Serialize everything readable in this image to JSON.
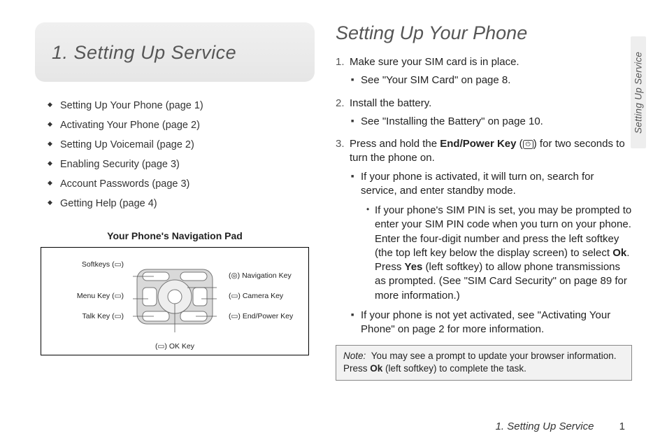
{
  "chapter_title": "1.  Setting Up Service",
  "side_tab": "Setting Up Service",
  "toc": [
    "Setting Up Your Phone (page 1)",
    "Activating Your Phone (page 2)",
    "Setting Up Voicemail (page 2)",
    "Enabling Security (page 3)",
    "Account Passwords (page 3)",
    "Getting Help (page 4)"
  ],
  "diagram": {
    "title": "Your Phone's Navigation Pad",
    "left_labels": {
      "softkeys": "Softkeys (▭)",
      "menu": "Menu Key (▭)",
      "talk": "Talk Key (▭)"
    },
    "right_labels": {
      "nav": "(◎) Navigation Key",
      "camera": "(▭) Camera Key",
      "end": "(▭) End/Power Key"
    },
    "bottom_label": "(▭) OK Key"
  },
  "section_title": "Setting Up Your Phone",
  "steps": {
    "s1": "Make sure your SIM card is in place.",
    "s1_sub": "See \"Your SIM Card\" on page 8.",
    "s2": "Install the battery.",
    "s2_sub": "See \"Installing the Battery\" on page 10.",
    "s3_a": "Press and hold the ",
    "s3_key": "End/Power Key",
    "s3_b": " (",
    "s3_c": ") for two seconds to turn the phone on.",
    "s3_sub1": "If your phone is activated, it will turn on, search for service, and enter standby mode.",
    "s3_sub2_a": "If your phone's SIM PIN is set, you may be prompted to enter your SIM PIN code when you turn on your phone. Enter the four-digit number and press the left softkey (the top left key below the display screen) to select ",
    "s3_sub2_ok": "Ok",
    "s3_sub2_b": ". Press ",
    "s3_sub2_yes": "Yes",
    "s3_sub2_c": " (left softkey) to allow phone transmissions as prompted. (See \"SIM Card Security\" on page 89 for more information.)",
    "s3_sub3": "If your phone is not yet activated, see \"Activating Your Phone\" on page 2 for more information."
  },
  "note": {
    "label": "Note:",
    "text_a": "You may see a prompt to update your browser information. Press ",
    "ok": "Ok",
    "text_b": " (left softkey) to complete the task."
  },
  "footer": {
    "text": "1. Setting Up Service",
    "page": "1"
  }
}
